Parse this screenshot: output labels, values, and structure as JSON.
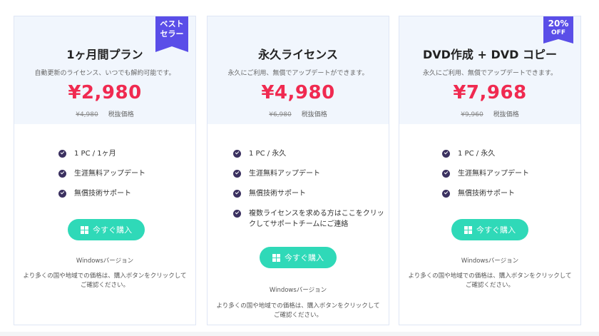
{
  "plans": [
    {
      "badge": [
        "ベスト",
        "セラー"
      ],
      "title": "1ヶ月間プラン",
      "subtitle": "自動更新のライセンス、いつでも解約可能です。",
      "price": "¥2,980",
      "old_price": "¥4,980",
      "tax_label": "税抜価格",
      "features": [
        "1 PC / 1ヶ月",
        "生涯無料アップデート",
        "無償技術サポート"
      ],
      "buy_label": "今すぐ購入",
      "version": "Windowsバージョン",
      "note": "より多くの国や地域での価格は、購入ボタンをクリックしてご確認ください。"
    },
    {
      "title": "永久ライセンス",
      "subtitle": "永久にご利用、無償でアップデートができます。",
      "price": "¥4,980",
      "old_price": "¥6,980",
      "tax_label": "税抜価格",
      "features": [
        "1 PC / 永久",
        "生涯無料アップデート",
        "無償技術サポート",
        "複数ライセンスを求める方はここをクリックしてサポートチームにご連絡"
      ],
      "buy_label": "今すぐ購入",
      "version": "Windowsバージョン",
      "note": "より多くの国や地域での価格は、購入ボタンをクリックしてご確認ください。"
    },
    {
      "badge": [
        "20%",
        "OFF"
      ],
      "title": "DVD作成 + DVD コピー",
      "subtitle": "永久にご利用、無償でアップデートできます。",
      "price": "¥7,968",
      "old_price": "¥9,960",
      "tax_label": "税抜価格",
      "features": [
        "1 PC / 永久",
        "生涯無料アップデート",
        "無償技術サポート"
      ],
      "buy_label": "今すぐ購入",
      "version": "Windowsバージョン",
      "note": "より多くの国や地域での価格は、購入ボタンをクリックしてご確認ください。"
    }
  ],
  "colors": {
    "price": "#f02a50",
    "accent": "#2fd9b8",
    "badge": "#5a4ee8",
    "check": "#3b3160"
  }
}
